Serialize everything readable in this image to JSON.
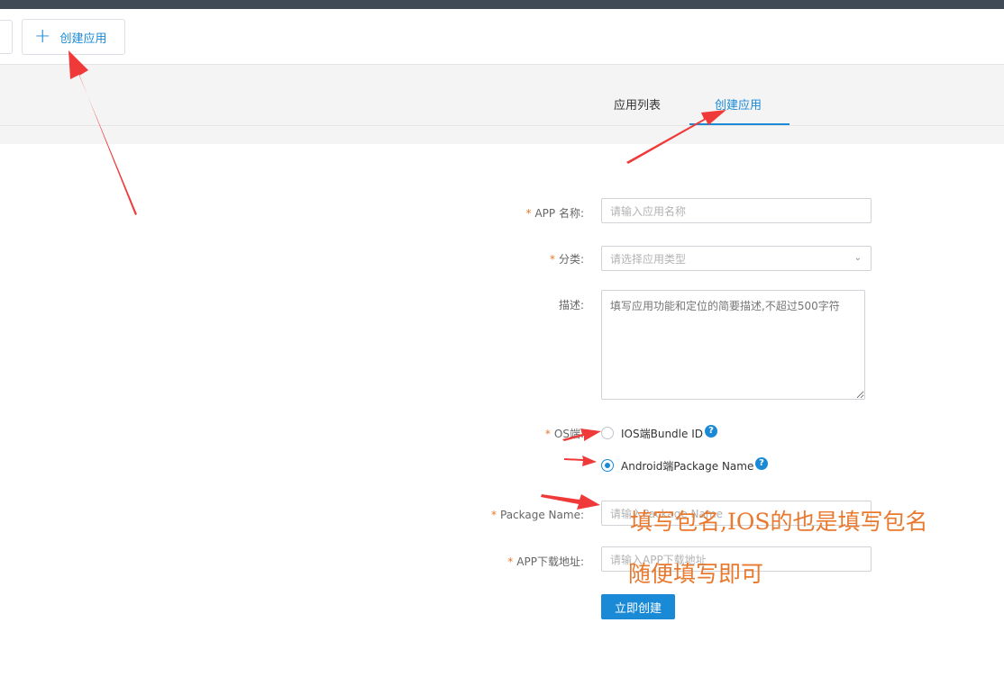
{
  "toolbar": {
    "create_button_label": "创建应用",
    "plus_icon": "plus-icon"
  },
  "tabs": [
    {
      "label": "应用列表",
      "active": false
    },
    {
      "label": "创建应用",
      "active": true
    }
  ],
  "form": {
    "app_name": {
      "label": "APP 名称:",
      "required": true,
      "value": "",
      "placeholder": "请输入应用名称"
    },
    "category": {
      "label": "分类:",
      "required": true,
      "value": "",
      "placeholder": "请选择应用类型"
    },
    "description": {
      "label": "描述:",
      "required": false,
      "value": "",
      "placeholder": "填写应用功能和定位的简要描述,不超过500字符"
    },
    "os": {
      "label": "OS端:",
      "required": true,
      "options": [
        {
          "label": "IOS端Bundle ID",
          "selected": false
        },
        {
          "label": "Android端Package Name",
          "selected": true
        }
      ],
      "help_glyph": "?"
    },
    "package_name": {
      "label": "Package Name:",
      "required": true,
      "value": "",
      "placeholder": "请输入Package Name"
    },
    "download_url": {
      "label": "APP下载地址:",
      "required": true,
      "value": "",
      "placeholder": "请输入APP下载地址"
    },
    "required_mark": "*",
    "submit_label": "立即创建"
  },
  "annotations": {
    "package_hint": "填写包名,IOS的也是填写包名",
    "url_hint": "随便填写即可"
  },
  "colors": {
    "accent": "#1a8ad6",
    "topbar": "#3f4a56",
    "annotation": "#e8792f",
    "arrow": "#f03a3a"
  }
}
